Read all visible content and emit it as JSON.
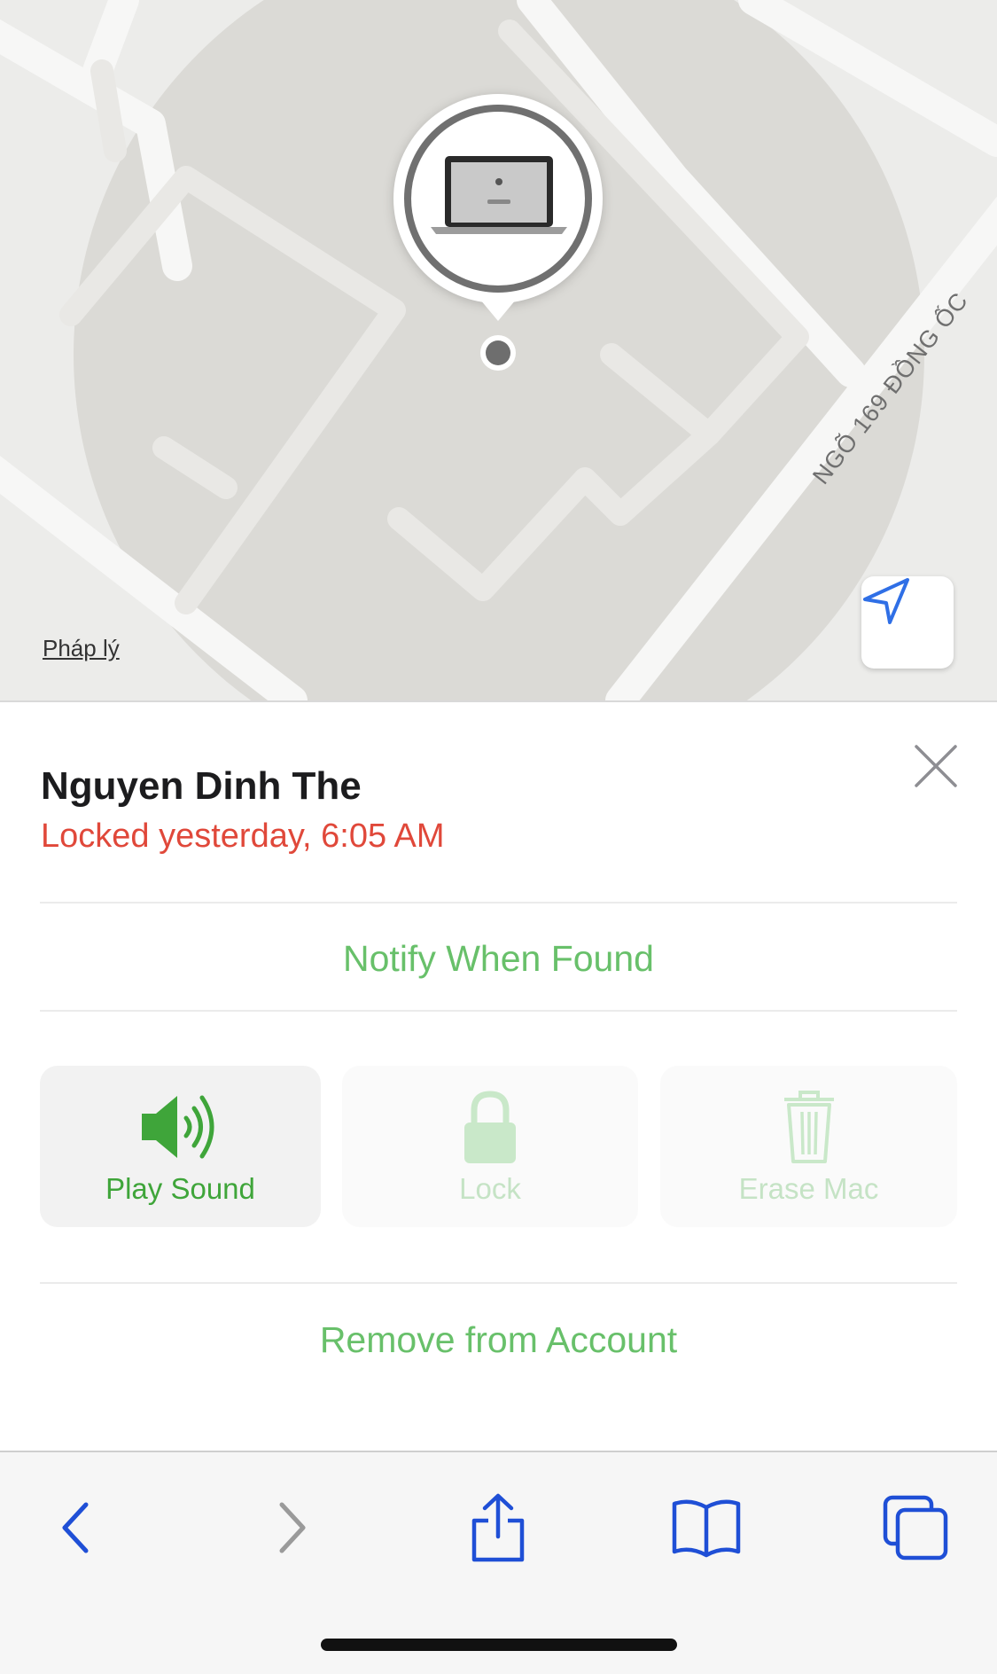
{
  "map": {
    "street_label": "NGÕ 169 ĐỒNG ỐC",
    "legal_link": "Pháp lý",
    "device_pin_icon": "macbook-icon",
    "locate_icon": "location-arrow-icon"
  },
  "device": {
    "name": "Nguyen Dinh The",
    "status": "Locked yesterday, 6:05 AM",
    "status_color": "#e0483a"
  },
  "actions": {
    "notify_label": "Notify When Found",
    "play_sound_label": "Play Sound",
    "lock_label": "Lock",
    "erase_label": "Erase Mac",
    "remove_label": "Remove from Account",
    "accent_color": "#68c06a"
  },
  "toolbar": {
    "items": [
      "back-icon",
      "forward-icon",
      "share-icon",
      "bookmarks-icon",
      "tabs-icon"
    ]
  }
}
